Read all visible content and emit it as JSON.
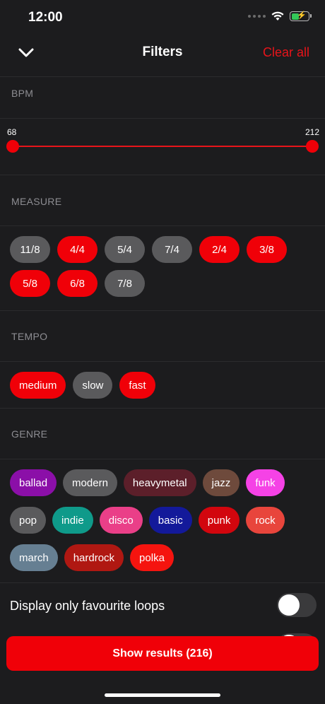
{
  "status_bar": {
    "time": "12:00"
  },
  "nav": {
    "title": "Filters",
    "clear_label": "Clear all"
  },
  "bpm": {
    "label": "BPM",
    "min": "68",
    "max": "212",
    "low_value": 68,
    "high_value": 212
  },
  "measure": {
    "label": "MEASURE",
    "chips": [
      {
        "label": "11/8",
        "selected": false
      },
      {
        "label": "4/4",
        "selected": true
      },
      {
        "label": "5/4",
        "selected": false
      },
      {
        "label": "7/4",
        "selected": false
      },
      {
        "label": "2/4",
        "selected": true
      },
      {
        "label": "3/8",
        "selected": true
      },
      {
        "label": "5/8",
        "selected": true
      },
      {
        "label": "6/8",
        "selected": true
      },
      {
        "label": "7/8",
        "selected": false
      }
    ]
  },
  "tempo": {
    "label": "TEMPO",
    "chips": [
      {
        "label": "medium",
        "selected": true
      },
      {
        "label": "slow",
        "selected": false
      },
      {
        "label": "fast",
        "selected": true
      }
    ]
  },
  "genre": {
    "label": "GENRE",
    "chips": [
      {
        "label": "ballad",
        "color": "#8b0fa8"
      },
      {
        "label": "modern",
        "color": "#5a5a5c"
      },
      {
        "label": "heavymetal",
        "color": "#5c1f2a"
      },
      {
        "label": "jazz",
        "color": "#6e4a3c"
      },
      {
        "label": "funk",
        "color": "#f542e6"
      },
      {
        "label": "pop",
        "color": "#5a5a5c"
      },
      {
        "label": "indie",
        "color": "#0f9a8a"
      },
      {
        "label": "disco",
        "color": "#ea3f88"
      },
      {
        "label": "basic",
        "color": "#13199a"
      },
      {
        "label": "punk",
        "color": "#d2060e"
      },
      {
        "label": "rock",
        "color": "#e8453c"
      },
      {
        "label": "march",
        "color": "#667f92"
      },
      {
        "label": "hardrock",
        "color": "#b01812"
      },
      {
        "label": "polka",
        "color": "#f5140f"
      }
    ]
  },
  "colors": {
    "accent": "#f00008",
    "unselected": "#5a5a5c"
  },
  "favourites": {
    "label": "Display only favourite loops",
    "enabled": false
  },
  "show_button": {
    "label": "Show results (216)"
  }
}
